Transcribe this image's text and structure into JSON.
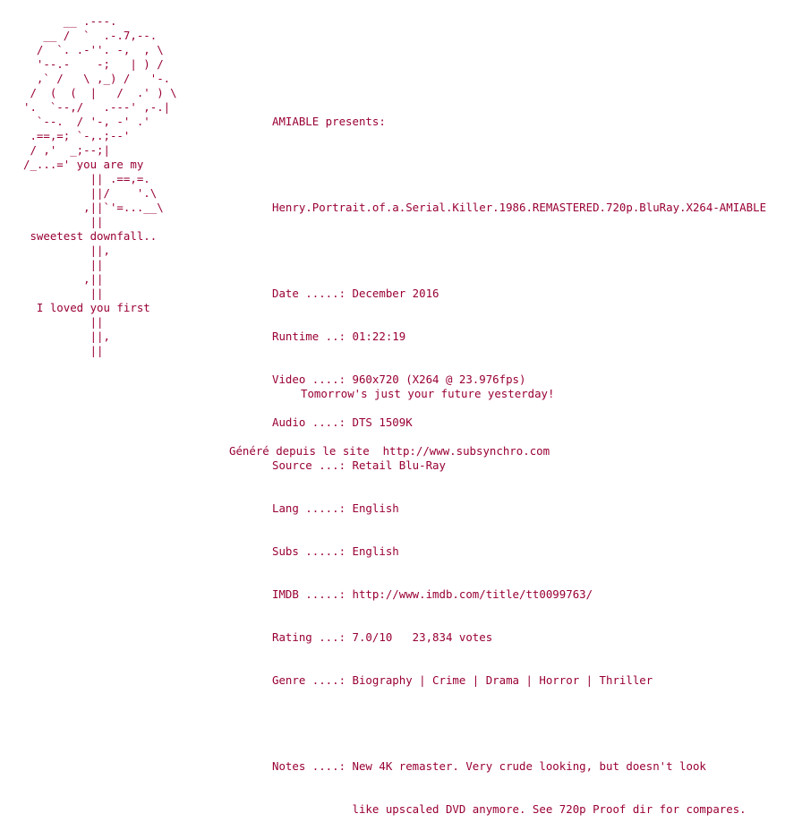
{
  "ascii_art": "      __ .---.\n   __ /  `  .-.7,--.\n  /  `. .-''. -,  , \\\n  '--.-    -;   | ) /\n  ,` /   \\ ,_) /   '-.\n /  (  (  |   /  .' ) \\\n'.  `--,/   .---' ,-.|\n  `--.  / '-, -' .'\n .==,=; `-,.;--'\n / ,'  _;--;|\n/_...=' you are my\n          || .==,=.\n          ||/    '.\\\n         ,||`'=...__\\\n          ||\n sweetest downfall..\n          ||,\n          ||\n         ,||\n          ||\n  I loved you first\n          ||\n          ||,\n          ||",
  "info_lines": [
    "AMIABLE presents:",
    "",
    "Henry.Portrait.of.a.Serial.Killer.1986.REMASTERED.720p.BluRay.X264-AMIABLE",
    "",
    "Date .....: December 2016",
    "Runtime ..: 01:22:19",
    "Video ....: 960x720 (X264 @ 23.976fps)",
    "Audio ....: DTS 1509K",
    "Source ...: Retail Blu-Ray",
    "Lang .....: English",
    "Subs .....: English",
    "IMDB .....: http://www.imdb.com/title/tt0099763/",
    "Rating ...: 7.0/10   23,834 votes",
    "Genre ....: Biography | Crime | Drama | Horror | Thriller",
    "",
    "Notes ....: New 4K remaster. Very crude looking, but doesn't look",
    "            like upscaled DVD anymore. See 720p Proof dir for compares."
  ],
  "tagline": "Tomorrow's just your future yesterday!",
  "footer": "Généré depuis le site  http://www.subsynchro.com",
  "colors": {
    "text": "#990033",
    "background": "#ffffff"
  }
}
